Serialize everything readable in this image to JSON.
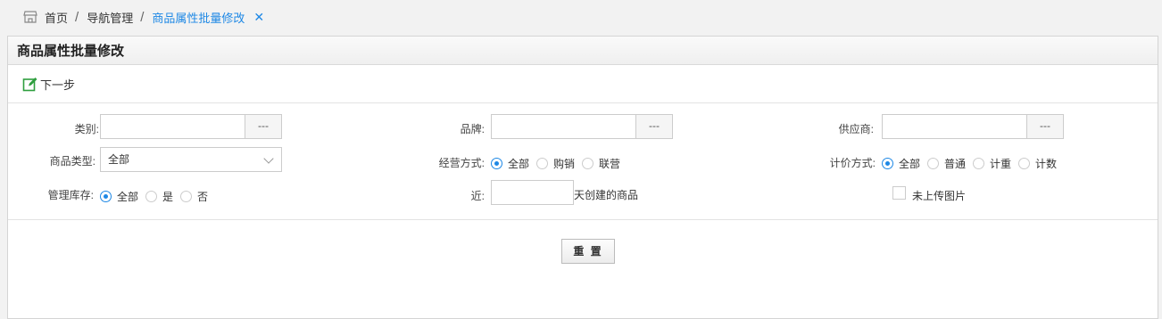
{
  "breadcrumb": {
    "items": [
      "首页",
      "导航管理",
      "商品属性批量修改"
    ],
    "close_symbol": "✕"
  },
  "panel": {
    "title": "商品属性批量修改",
    "toolbar": {
      "next_label": "下一步"
    }
  },
  "form": {
    "category": {
      "label": "类别:",
      "value": "",
      "picker_label": "---"
    },
    "brand": {
      "label": "品牌:",
      "value": "",
      "picker_label": "---"
    },
    "supplier": {
      "label": "供应商:",
      "value": "",
      "picker_label": "---"
    },
    "product_type": {
      "label": "商品类型:",
      "selected": "全部"
    },
    "operation_mode": {
      "label": "经营方式:",
      "options": [
        "全部",
        "购销",
        "联营"
      ],
      "selected_index": 0
    },
    "pricing_mode": {
      "label": "计价方式:",
      "options": [
        "全部",
        "普通",
        "计重",
        "计数"
      ],
      "selected_index": 0
    },
    "manage_stock": {
      "label": "管理库存:",
      "options": [
        "全部",
        "是",
        "否"
      ],
      "selected_index": 0
    },
    "recent": {
      "label": "近:",
      "value": "",
      "suffix": "天创建的商品"
    },
    "no_image": {
      "label": "未上传图片",
      "checked": false
    }
  },
  "actions": {
    "reset_label": "重 置"
  },
  "colors": {
    "accent": "#1e88e5",
    "toolbar_icon": "#2e9e3e"
  }
}
